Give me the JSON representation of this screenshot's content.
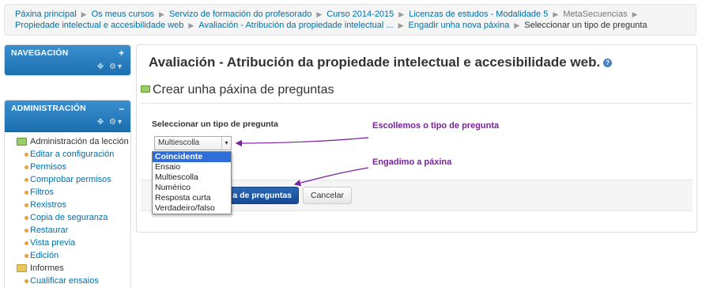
{
  "breadcrumb": {
    "items": [
      "Páxina principal",
      "Os meus cursos",
      "Servizo de formación do profesorado",
      "Curso 2014-2015",
      "Licenzas de estudos - Modalidade 5",
      "MetaSecuencias",
      "Propiedade intelectual e accesibilidade web",
      "Avaliación - Atribución da propiedade intelectual ...",
      "Engadir unha nova páxina",
      "Seleccionar un tipo de pregunta"
    ]
  },
  "nav_block": {
    "title": "NAVEGACIÓN",
    "toggle": "+"
  },
  "admin_block": {
    "title": "ADMINISTRACIÓN",
    "toggle": "–",
    "root": "Administración da lección",
    "items": [
      "Editar a configuración",
      "Permisos",
      "Comprobar permisos",
      "Filtros",
      "Rexistros",
      "Copia de seguranza",
      "Restaurar",
      "Vista previa",
      "Edición"
    ],
    "folder": "Informes",
    "last": "Cualificar ensaios"
  },
  "main": {
    "title": "Avaliación - Atribución da propiedade intelectual e accesibilidade web.",
    "subtitle": "Crear unha páxina de preguntas",
    "form_label": "Seleccionar un tipo de pregunta",
    "select_value": "Multiescolla",
    "options": [
      "Coincidente",
      "Ensaio",
      "Multiescolla",
      "Numérico",
      "Resposta curta",
      "Verdadeiro/falso"
    ],
    "selected_option": "Coincidente",
    "primary_button_visible": "a de preguntas",
    "cancel_button": "Cancelar"
  },
  "annotations": {
    "choose_type": "Escollemos o tipo de pregunta",
    "add_page": "Engadimo a páxina"
  },
  "colors": {
    "block_header": "#1f7abf",
    "link": "#0070a8",
    "annotation": "#7a1f9e",
    "primary_button": "#174a93",
    "selected_option": "#2e6ed6"
  }
}
